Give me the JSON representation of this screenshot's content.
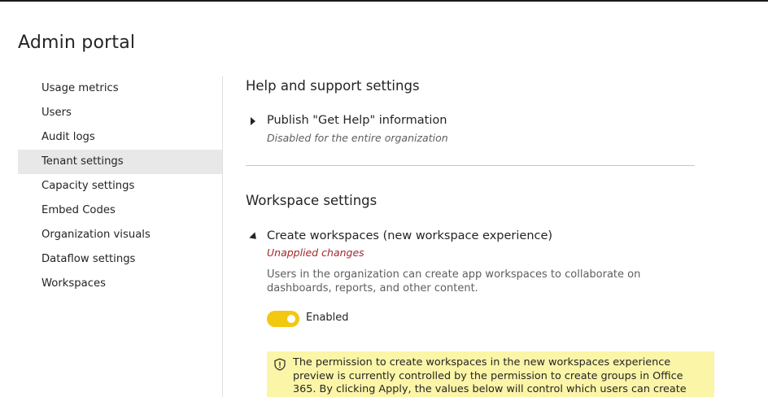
{
  "page": {
    "title": "Admin portal"
  },
  "sidebar": {
    "items": [
      {
        "label": "Usage metrics"
      },
      {
        "label": "Users"
      },
      {
        "label": "Audit logs"
      },
      {
        "label": "Tenant settings"
      },
      {
        "label": "Capacity settings"
      },
      {
        "label": "Embed Codes"
      },
      {
        "label": "Organization visuals"
      },
      {
        "label": "Dataflow settings"
      },
      {
        "label": "Workspaces"
      }
    ],
    "active_item": "Tenant settings"
  },
  "sections": {
    "help": {
      "title": "Help and support settings",
      "setting": {
        "title": "Publish \"Get Help\" information",
        "status": "Disabled for the entire organization",
        "expanded": false
      }
    },
    "workspace": {
      "title": "Workspace settings",
      "setting": {
        "title": "Create workspaces (new workspace experience)",
        "status": "Unapplied changes",
        "description": "Users in the organization can create app workspaces to collaborate on dashboards, reports, and other content.",
        "toggle_label": "Enabled",
        "toggle_on": true,
        "expanded": true,
        "warning": "The permission to create workspaces in the new workspaces experience preview is currently controlled by the permission to create groups in Office 365. By clicking Apply, the values below will control which users can create workspaces in the new"
      }
    }
  },
  "colors": {
    "toggle_on": "#f2c811",
    "warning_bg": "#fbf5a8",
    "unapplied_text": "#a4262c",
    "active_nav_bg": "#e8e8e8"
  },
  "icons": {
    "collapsed_caret": "caret-right-icon",
    "expanded_caret": "caret-down-icon",
    "warning": "shield-warning-icon"
  }
}
